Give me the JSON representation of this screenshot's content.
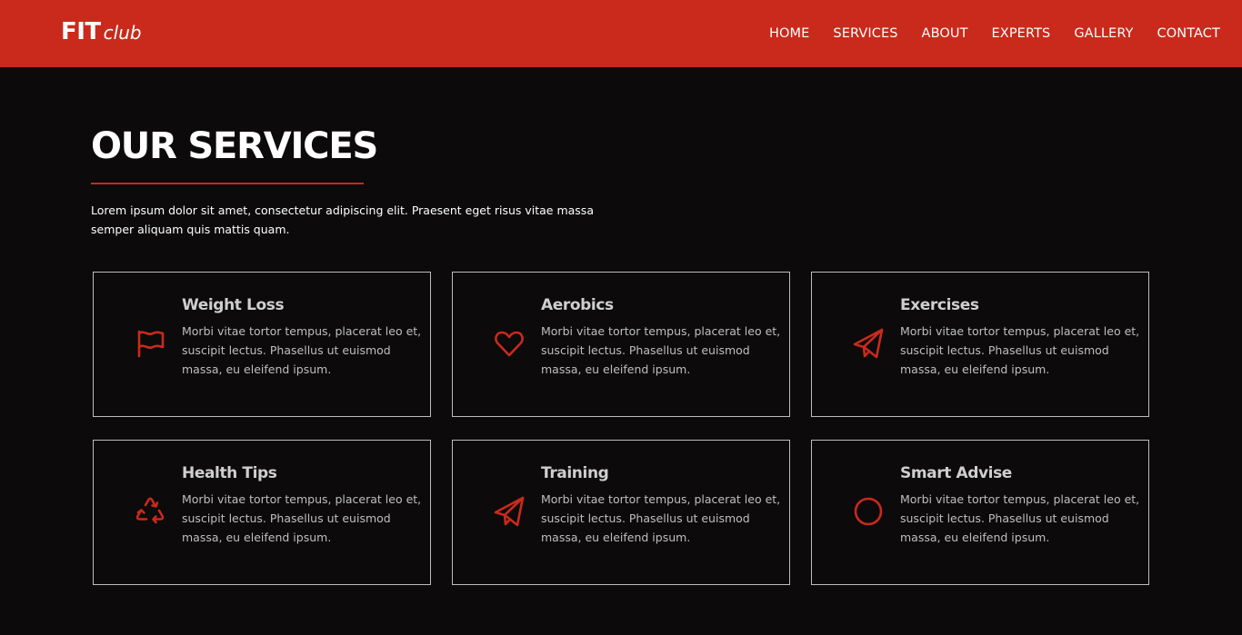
{
  "brand": {
    "fit": "FIT",
    "club": "club"
  },
  "nav": [
    "HOME",
    "SERVICES",
    "ABOUT",
    "EXPERTS",
    "GALLERY",
    "CONTACT"
  ],
  "services": {
    "title": "OUR SERVICES",
    "intro": "Lorem ipsum dolor sit amet, consectetur adipiscing elit. Praesent eget risus vitae massa semper aliquam quis mattis quam.",
    "cards": [
      {
        "title": "Weight Loss",
        "text": "Morbi vitae tortor tempus, placerat leo et, suscipit lectus. Phasellus ut euismod massa, eu eleifend ipsum.",
        "icon": "flag-icon"
      },
      {
        "title": "Aerobics",
        "text": "Morbi vitae tortor tempus, placerat leo et, suscipit lectus. Phasellus ut euismod massa, eu eleifend ipsum.",
        "icon": "heart-icon"
      },
      {
        "title": "Exercises",
        "text": "Morbi vitae tortor tempus, placerat leo et, suscipit lectus. Phasellus ut euismod massa, eu eleifend ipsum.",
        "icon": "paper-plane-icon"
      },
      {
        "title": "Health Tips",
        "text": "Morbi vitae tortor tempus, placerat leo et, suscipit lectus. Phasellus ut euismod massa, eu eleifend ipsum.",
        "icon": "recycle-icon"
      },
      {
        "title": "Training",
        "text": "Morbi vitae tortor tempus, placerat leo et, suscipit lectus. Phasellus ut euismod massa, eu eleifend ipsum.",
        "icon": "paper-plane-icon"
      },
      {
        "title": "Smart Advise",
        "text": "Morbi vitae tortor tempus, placerat leo et, suscipit lectus. Phasellus ut euismod massa, eu eleifend ipsum.",
        "icon": "circle-icon"
      }
    ]
  },
  "colors": {
    "accent": "#c92a1b",
    "background": "#0c0a0a",
    "card_border": "#bdbdbd",
    "card_title": "#cfcfcf",
    "card_text": "#bfbfbf"
  }
}
